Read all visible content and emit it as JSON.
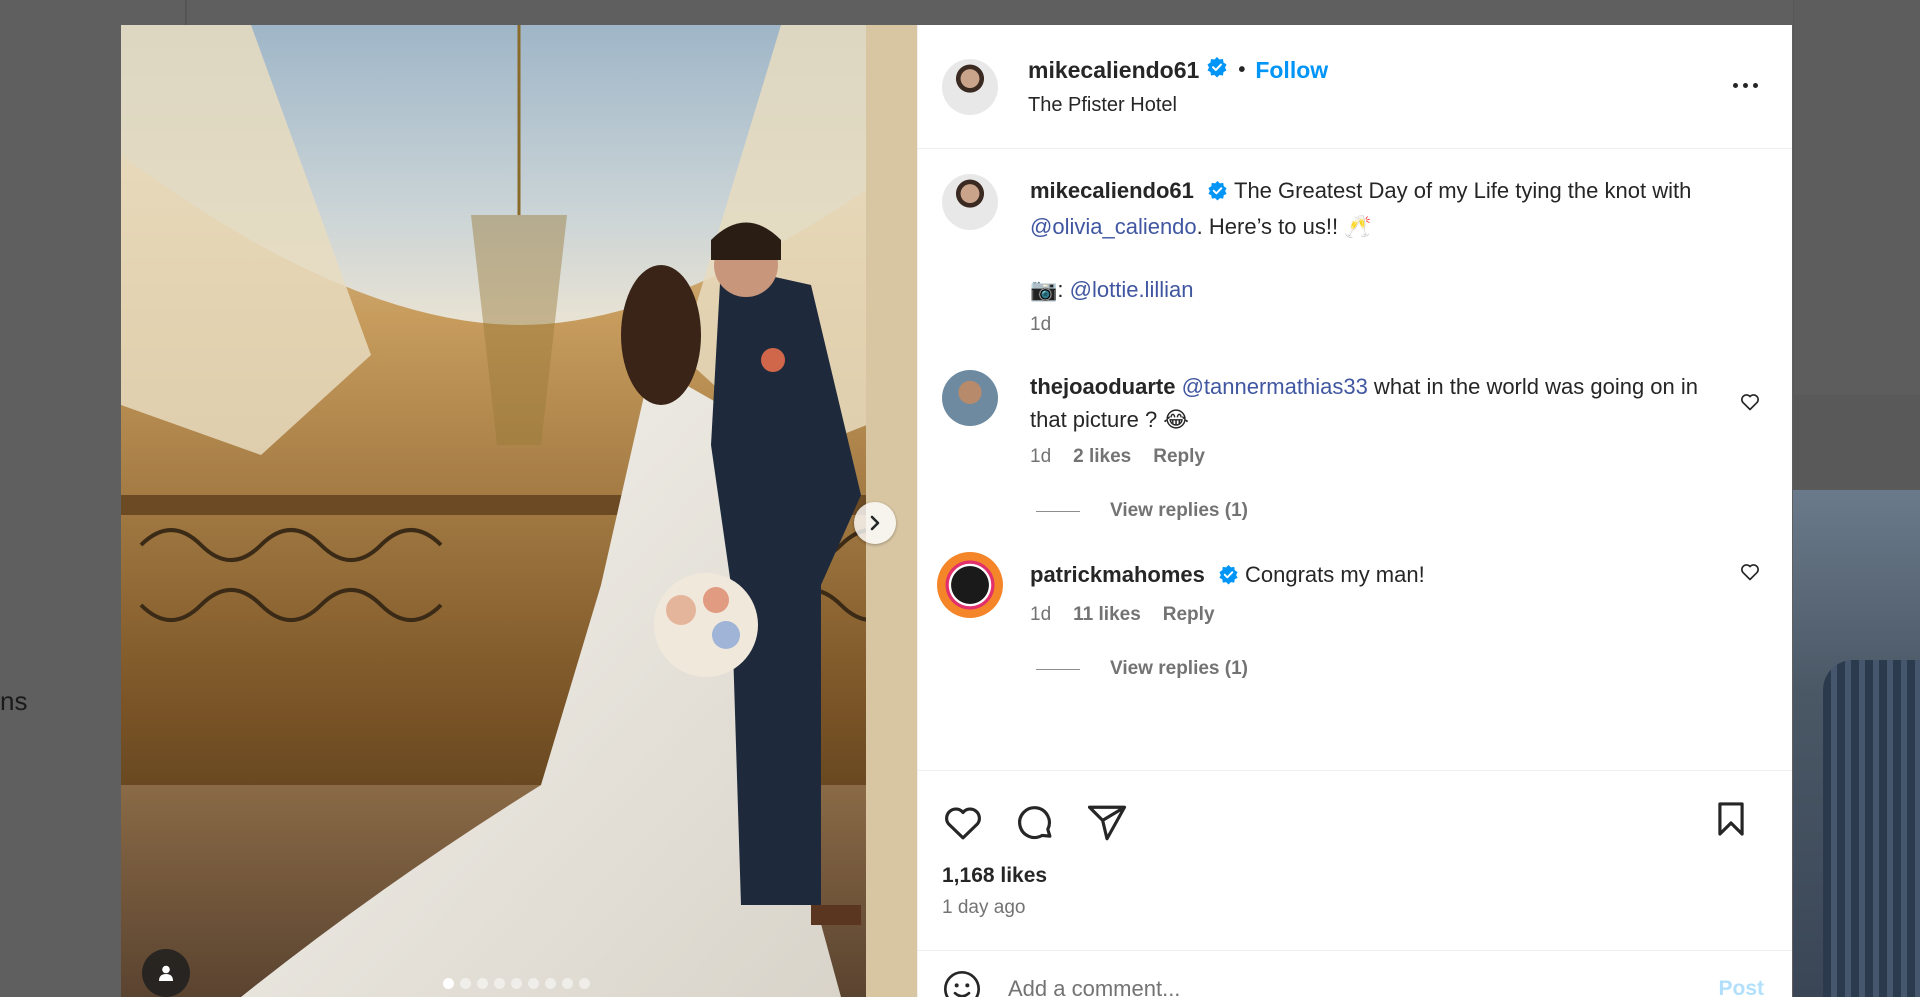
{
  "background": {
    "partial_text": "ns"
  },
  "post": {
    "author": "mikecaliendo61",
    "follow_label": "Follow",
    "separator": "•",
    "location": "The Pfister Hotel",
    "carousel": {
      "slide_count": 9,
      "active_index": 0
    }
  },
  "caption": {
    "username": "mikecaliendo61",
    "text_before": "The Greatest Day of my Life tying the knot with ",
    "mention": "@olivia_caliendo",
    "text_after": ". Here’s to us!! 🥂",
    "credit_emoji": "📷",
    "credit_sep": ": ",
    "credit_mention": "@lottie.lillian",
    "time": "1d"
  },
  "comments": [
    {
      "username": "thejoaoduarte",
      "mention": "@tannermathias33",
      "text": " what in the world was going on in that picture ? 😂",
      "time": "1d",
      "likes": "2 likes",
      "reply_label": "Reply",
      "view_replies": "View replies (1)",
      "verified": false
    },
    {
      "username": "patrickmahomes",
      "mention": "",
      "text": "Congrats my man!",
      "time": "1d",
      "likes": "11 likes",
      "reply_label": "Reply",
      "view_replies": "View replies (1)",
      "verified": true
    }
  ],
  "engagement": {
    "likes": "1,168 likes",
    "posted": "1 day ago"
  },
  "composer": {
    "placeholder": "Add a comment...",
    "post_label": "Post"
  },
  "colors": {
    "accent": "#0095f6",
    "mention": "#4056a1",
    "muted": "#737373",
    "overlay": "#616161"
  },
  "icons": {
    "verified": "verified-badge-icon",
    "more": "more-options-icon",
    "like": "heart-icon",
    "comment": "comment-bubble-icon",
    "share": "paper-plane-icon",
    "save": "bookmark-icon",
    "emoji": "emoji-smiley-icon",
    "next": "chevron-right-icon",
    "tag": "user-tag-icon"
  }
}
